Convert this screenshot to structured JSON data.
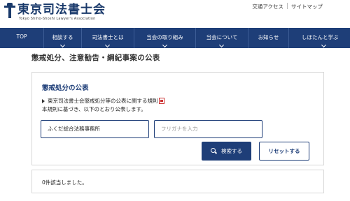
{
  "header": {
    "logo_title": "東京司法書士会",
    "logo_subtitle": "Tokyo Shiho-Shoshi Lawyer's Association",
    "utility_links": [
      "交通アクセス",
      "サイトマップ"
    ]
  },
  "nav": {
    "items": [
      {
        "label": "TOP",
        "dropdown": false
      },
      {
        "label": "相談する",
        "dropdown": true
      },
      {
        "label": "司法書士とは",
        "dropdown": true
      },
      {
        "label": "当会の取り組み",
        "dropdown": true
      },
      {
        "label": "当会について",
        "dropdown": true
      },
      {
        "label": "お知らせ",
        "dropdown": false
      },
      {
        "label": "しほたんと学ぶ",
        "dropdown": true
      }
    ]
  },
  "page": {
    "title": "懲戒処分、注意勧告・綱紀事案の公表"
  },
  "search_card": {
    "title": "懲戒処分の公表",
    "rule_link": "東京司法書士会懲戒処分等の公表に関する規則",
    "description": "本規則に基づき、以下のとおり公表します。",
    "name_input_value": "ふくだ総合法務事務所",
    "kana_input_placeholder": "フリガナを入力",
    "search_button": "検索する",
    "reset_button": "リセットする"
  },
  "result": {
    "text": "0件該当しました。"
  },
  "colors": {
    "navy": "#1e3e78",
    "pdf_red": "#cc3333"
  }
}
